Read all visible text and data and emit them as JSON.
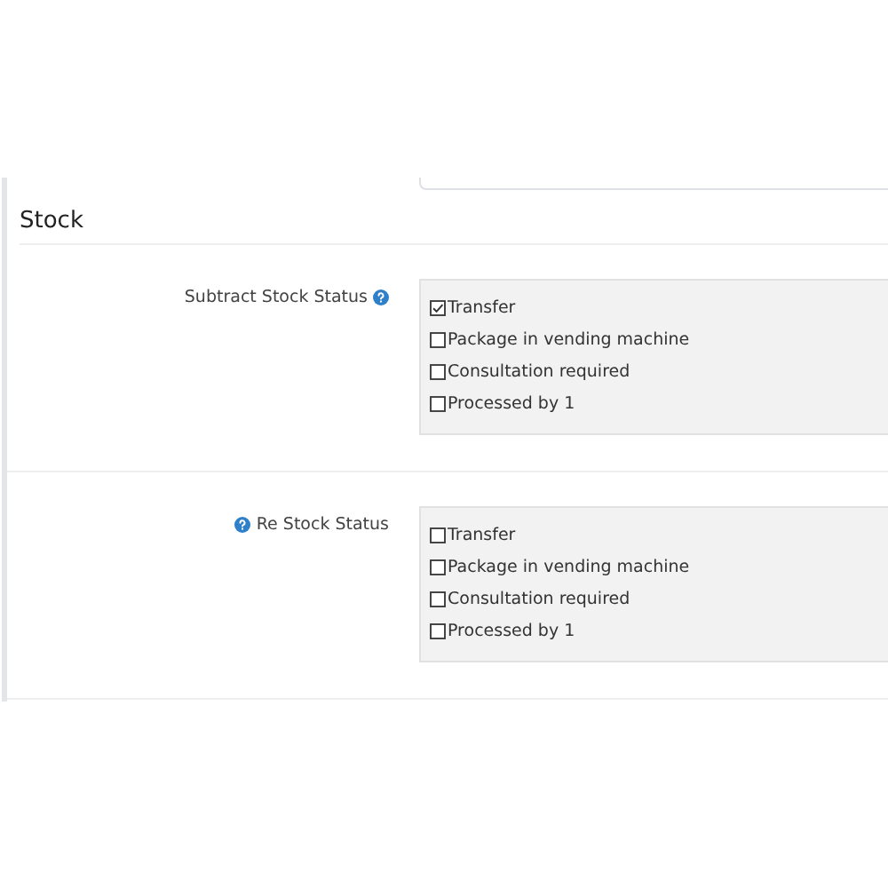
{
  "section": {
    "title": "Stock"
  },
  "fields": [
    {
      "label_parts": [
        {
          "kind": "text",
          "text": "Subtract Stock Status"
        },
        {
          "kind": "help"
        }
      ],
      "options": [
        {
          "label": "Transfer",
          "checked": true
        },
        {
          "label": "Package in vending machine",
          "checked": false
        },
        {
          "label": "Consultation required",
          "checked": false
        },
        {
          "label": "Processed by 1",
          "checked": false
        }
      ]
    },
    {
      "label_parts": [
        {
          "kind": "help"
        },
        {
          "kind": "text",
          "text": "Re Stock Status"
        }
      ],
      "options": [
        {
          "label": "Transfer",
          "checked": false
        },
        {
          "label": "Package in vending machine",
          "checked": false
        },
        {
          "label": "Consultation required",
          "checked": false
        },
        {
          "label": "Processed by 1",
          "checked": false
        }
      ]
    }
  ]
}
